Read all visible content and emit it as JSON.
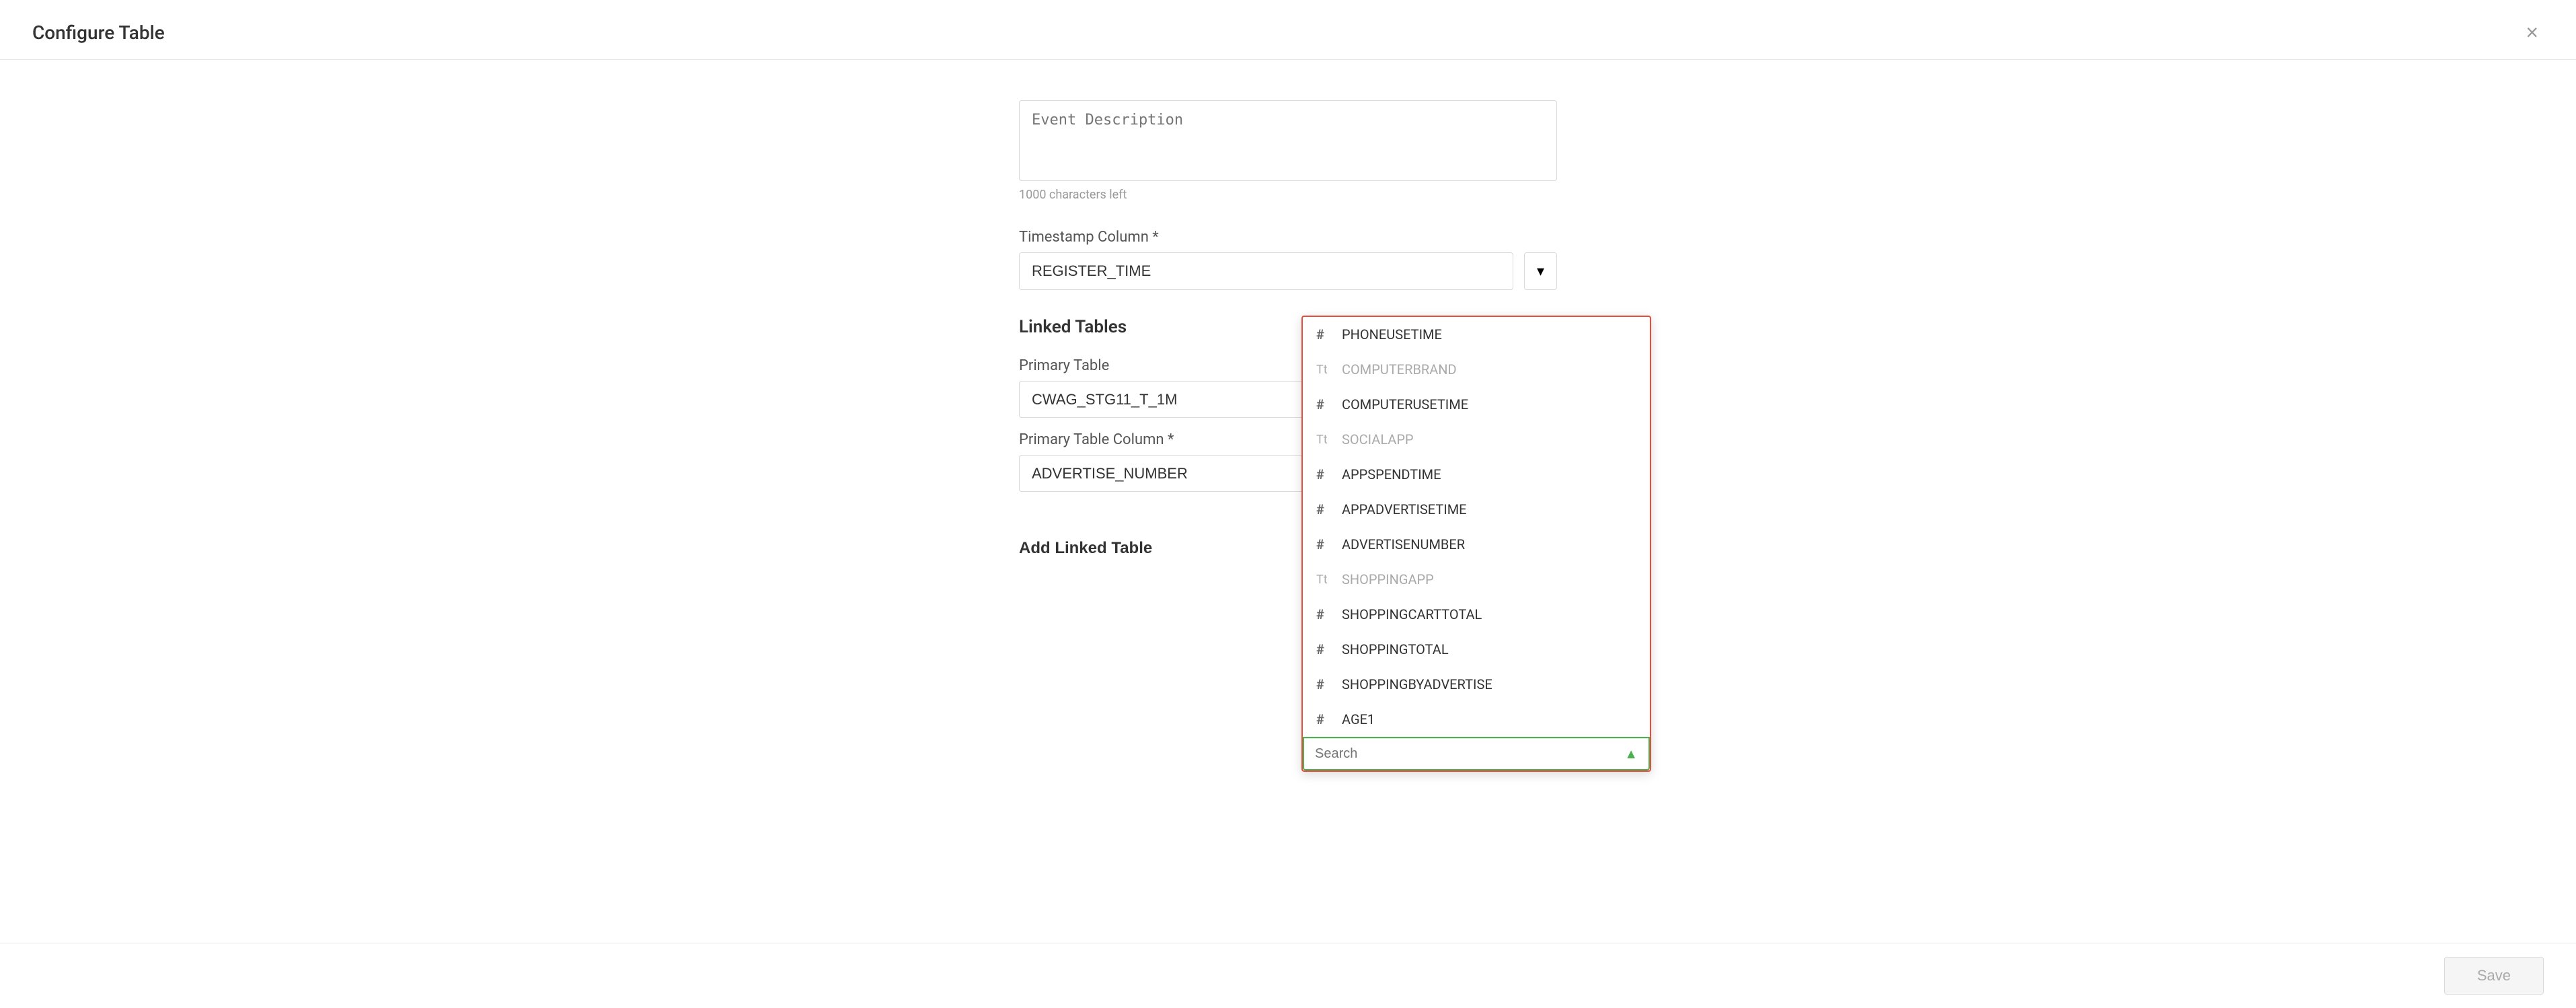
{
  "modal": {
    "title": "Configure Table",
    "close_label": "×"
  },
  "form": {
    "event_description_label": "Event Description",
    "event_description_placeholder": "Event Description",
    "char_count": "1000 characters left",
    "timestamp_label": "Timestamp Column *",
    "timestamp_value": "REGISTER_TIME",
    "linked_tables_label": "Linked Tables",
    "primary_table_label": "Primary Table",
    "primary_table_value": "CWAG_STG11_T_1M",
    "primary_table_column_label": "Primary Table Column *",
    "primary_table_column_value": "ADVERTISE_NUMBER",
    "add_linked_table_label": "Add Linked Table"
  },
  "dropdown": {
    "items": [
      {
        "type": "number",
        "label": "PHONEUSETIME"
      },
      {
        "type": "text",
        "label": "COMPUTERBRAND"
      },
      {
        "type": "number",
        "label": "COMPUTERUSETIME"
      },
      {
        "type": "text",
        "label": "SOCIALAPP"
      },
      {
        "type": "number",
        "label": "APPSPENDTIME"
      },
      {
        "type": "number",
        "label": "APPADVERTISETIME"
      },
      {
        "type": "number",
        "label": "ADVERTISENUMBER"
      },
      {
        "type": "text",
        "label": "SHOPPINGAPP"
      },
      {
        "type": "number",
        "label": "SHOPPINGCARTTOTAL"
      },
      {
        "type": "number",
        "label": "SHOPPINGTOTAL"
      },
      {
        "type": "number",
        "label": "SHOPPINGBYADVERTISE"
      },
      {
        "type": "number",
        "label": "AGE1"
      }
    ],
    "search_placeholder": "Search"
  },
  "footer": {
    "save_label": "Save"
  },
  "icons": {
    "hash": "#",
    "text_type": "Tt",
    "link": "⇌",
    "arrow": "←→",
    "dots": "⋮",
    "dropdown_arrow": "▾",
    "search_up": "▲"
  }
}
